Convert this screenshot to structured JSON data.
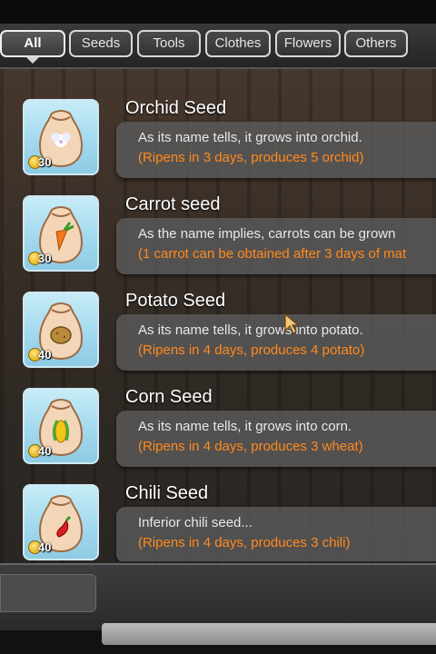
{
  "tabs": [
    {
      "label": "All",
      "active": true
    },
    {
      "label": "Seeds",
      "active": false
    },
    {
      "label": "Tools",
      "active": false
    },
    {
      "label": "Clothes",
      "active": false
    },
    {
      "label": "Flowers",
      "active": false
    },
    {
      "label": "Others",
      "active": false
    }
  ],
  "items": [
    {
      "name": "Orchid Seed",
      "price": "30",
      "description": "As its name tells, it grows into orchid.",
      "note": "(Ripens in 3 days, produces 5 orchid)",
      "icon": "orchid-seed-bag-icon"
    },
    {
      "name": "Carrot seed",
      "price": "30",
      "description": "As the name implies, carrots can be grown",
      "note": "(1 carrot can be obtained after 3 days of mat",
      "icon": "carrot-seed-bag-icon"
    },
    {
      "name": "Potato Seed",
      "price": "40",
      "description": "As its name tells, it grows into potato.",
      "note": "(Ripens in 4 days, produces 4 potato)",
      "icon": "potato-seed-bag-icon"
    },
    {
      "name": "Corn Seed",
      "price": "40",
      "description": "As its name tells, it grows into corn.",
      "note": "(Ripens in 4 days, produces 3 wheat)",
      "icon": "corn-seed-bag-icon"
    },
    {
      "name": "Chili Seed",
      "price": "40",
      "description": "Inferior chili seed...",
      "note": "(Ripens in 4 days, produces 3 chili)",
      "icon": "chili-seed-bag-icon"
    }
  ],
  "colors": {
    "note": "#ff8a1e",
    "panel": "#5a5a5a",
    "icon_bg": "#a3d9ee"
  }
}
